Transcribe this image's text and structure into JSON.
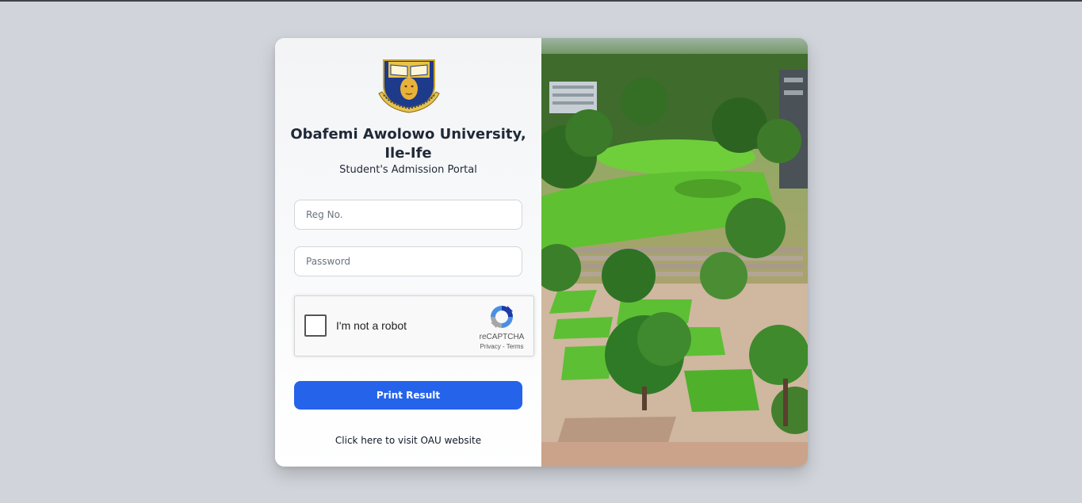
{
  "university": {
    "name": "Obafemi Awolowo University,",
    "location": "Ile-Ife",
    "portal": "Student's Admission Portal"
  },
  "form": {
    "reg_placeholder": "Reg No.",
    "password_placeholder": "Password",
    "submit_label": "Print Result"
  },
  "captcha": {
    "label": "I'm not a robot",
    "brand": "reCAPTCHA",
    "links": "Privacy - Terms"
  },
  "footer": {
    "visit_link": "Click here to visit OAU website"
  },
  "colors": {
    "accent": "#2563eb",
    "page_bg": "#d1d5db"
  }
}
